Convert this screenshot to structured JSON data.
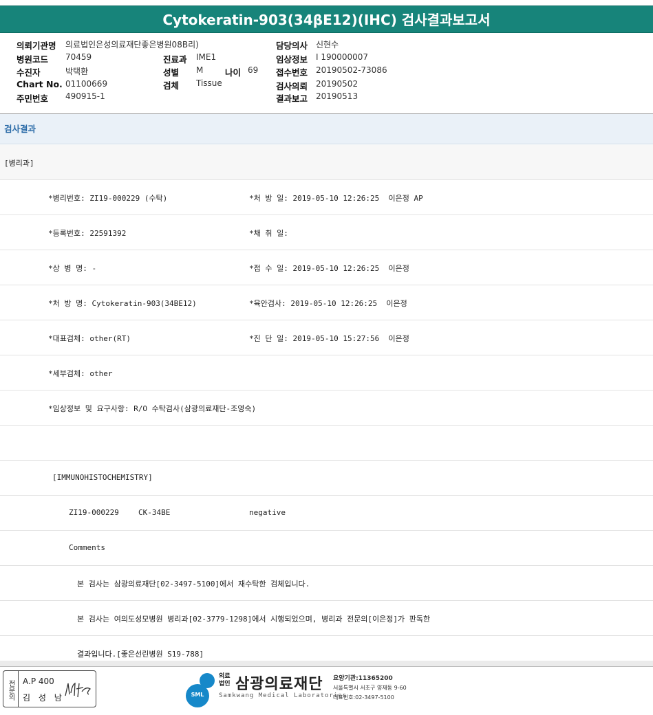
{
  "report": {
    "title": "Cytokeratin-903(34βE12)(IHC) 검사결과보고서"
  },
  "patient": {
    "institution_label": "의뢰기관명",
    "institution": "의료법인은성의료재단좋은병원08B리)",
    "hospital_code_label": "병원코드",
    "hospital_code": "70459",
    "patient_label": "수진자",
    "patient_name": "박택환",
    "chart_label": "Chart No.",
    "chart_no": "01100669",
    "rrn_label": "주민번호",
    "rrn": "490915-1",
    "dept_label": "진료과",
    "dept": "IME1",
    "sex_label": "성별",
    "sex": "M",
    "age_label": "나이",
    "age": "69",
    "specimen_label": "검체",
    "specimen": "Tissue",
    "doctor_label": "담당의사",
    "doctor": "신현수",
    "clinical_label": "임상정보",
    "clinical": "I 190000007",
    "receipt_label": "접수번호",
    "receipt": "20190502-73086",
    "request_label": "검사의뢰",
    "request_date": "20190502",
    "result_label": "결과보고",
    "result_date": "20190513"
  },
  "results": {
    "section_title": "검사결과",
    "dept_line": "[병리과]",
    "pathology_no": "*병리번호: ZI19-000229 (수탁)",
    "order_date": "*처 방 일: 2019-05-10 12:26:25  이은정 AP",
    "reg_no": "*등록번호: 22591392",
    "collect_date": "*채 취 일:",
    "disease_name": "*상 병 명: -",
    "receive_date": "*접 수 일: 2019-05-10 12:26:25  이은정",
    "order_name": "*처 방 명: Cytokeratin-903(34BE12)",
    "gross_exam": "*육안검사: 2019-05-10 12:26:25  이은정",
    "main_specimen": "*대표검체: other(RT)",
    "diagnosis_date": "*진 단 일: 2019-05-10 15:27:56  이은정",
    "sub_specimen": "*세부검체: other",
    "clinical_req": "*임상정보 및 요구사항: R/O 수탁검사(삼광의료재단-조영숙)",
    "ihc_header": "[IMMUNOHISTOCHEMISTRY]",
    "ihc_case": "ZI19-000229",
    "ihc_marker": "CK-34BE",
    "ihc_result": "negative",
    "comments_label": "Comments",
    "comment_1": "본 검사는 삼광의료재단[02-3497-5100]에서 재수탁한 검체입니다.",
    "comment_2": "본 검사는 여의도성모병원 병리과[02-3779-1298]에서 시행되었으며, 병리과 전문의[이은정]가 판독한",
    "comment_3": "결과입니다.[좋은선린병원 S19-788]"
  },
  "footer": {
    "sign_vertical": "전문의",
    "sign_ap": "A.P 400",
    "sign_name": "김 성 남",
    "logo_mark": "SML",
    "logo_legal": "의료 법인",
    "logo_brand": "삼광의료재단",
    "logo_eng": "Samkwang Medical Laboratories",
    "care_no": "요양기관:11365200",
    "address": "서울특별시 서초구 양재동 9-60",
    "phone": "대표번호:02-3497-5100"
  }
}
